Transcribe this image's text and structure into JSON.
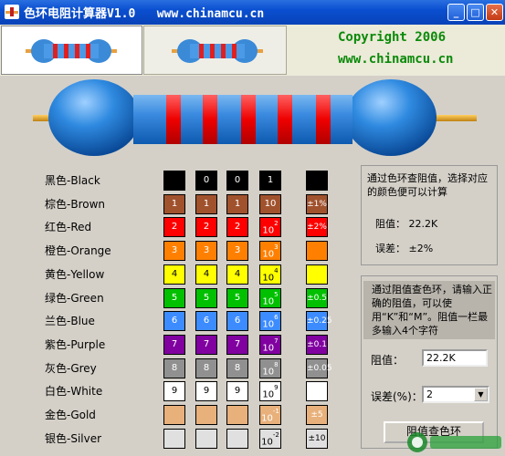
{
  "window": {
    "title": "色环电阻计算器V1.0   www.chinamcu.cn",
    "controls": {
      "minimize": "_",
      "maximize": "□",
      "close": "✕"
    }
  },
  "header": {
    "copyright": "Copyright 2006",
    "website": "www.chinamcu.cn"
  },
  "colors": [
    {
      "label": "黑色-Black",
      "hex": "#000000",
      "fg": "#ffffff",
      "digit": "0",
      "mult_base": "1",
      "mult_exp": "",
      "tol": ""
    },
    {
      "label": "棕色-Brown",
      "hex": "#a0522d",
      "fg": "#ffffff",
      "digit": "1",
      "mult_base": "10",
      "mult_exp": "",
      "tol": "±1%"
    },
    {
      "label": "红色-Red",
      "hex": "#ff0000",
      "fg": "#ffffff",
      "digit": "2",
      "mult_base": "10",
      "mult_exp": "2",
      "tol": "±2%"
    },
    {
      "label": "橙色-Orange",
      "hex": "#ff8000",
      "fg": "#ffffff",
      "digit": "3",
      "mult_base": "10",
      "mult_exp": "3",
      "tol": ""
    },
    {
      "label": "黄色-Yellow",
      "hex": "#ffff00",
      "fg": "#000000",
      "digit": "4",
      "mult_base": "10",
      "mult_exp": "4",
      "tol": ""
    },
    {
      "label": "绿色-Green",
      "hex": "#00c000",
      "fg": "#ffffff",
      "digit": "5",
      "mult_base": "10",
      "mult_exp": "5",
      "tol": "±0.5"
    },
    {
      "label": "兰色-Blue",
      "hex": "#3c8cff",
      "fg": "#ffffff",
      "digit": "6",
      "mult_base": "10",
      "mult_exp": "6",
      "tol": "±0.25"
    },
    {
      "label": "紫色-Purple",
      "hex": "#8000a0",
      "fg": "#ffffff",
      "digit": "7",
      "mult_base": "10",
      "mult_exp": "7",
      "tol": "±0.1"
    },
    {
      "label": "灰色-Grey",
      "hex": "#909090",
      "fg": "#ffffff",
      "digit": "8",
      "mult_base": "10",
      "mult_exp": "8",
      "tol": "±0.05"
    },
    {
      "label": "白色-White",
      "hex": "#ffffff",
      "fg": "#000000",
      "digit": "9",
      "mult_base": "10",
      "mult_exp": "9",
      "tol": ""
    },
    {
      "label": "金色-Gold",
      "hex": "#e8b07a",
      "fg": "#ffffff",
      "digit": "",
      "mult_base": "10",
      "mult_exp": "-1",
      "tol": "±5"
    },
    {
      "label": "银色-Silver",
      "hex": "#e0e0e0",
      "fg": "#000000",
      "digit": "",
      "mult_base": "10",
      "mult_exp": "-2",
      "tol": "±10"
    }
  ],
  "panel_color_to_value": {
    "description": "通过色环查阻值，选择对应的颜色便可以计算",
    "resistance_label": "阻值：",
    "resistance_value": "22.2K",
    "tolerance_label": "误差：",
    "tolerance_value": "±2%"
  },
  "panel_value_to_color": {
    "description": "通过阻值查色环，请输入正确的阻值，可以使用“K”和“M”。阻值一栏最多输入4个字符",
    "resistance_label": "阻值：",
    "resistance_input": "22.2K",
    "tolerance_label": "误差(%)：",
    "tolerance_select": "2",
    "submit_button": "阻值查色环"
  },
  "big_resistor_bands": [
    "#ff0000",
    "#ff0000",
    "#ff0000",
    "#ff0000",
    "#ff0000"
  ],
  "accent_green": "#0a8a0a"
}
